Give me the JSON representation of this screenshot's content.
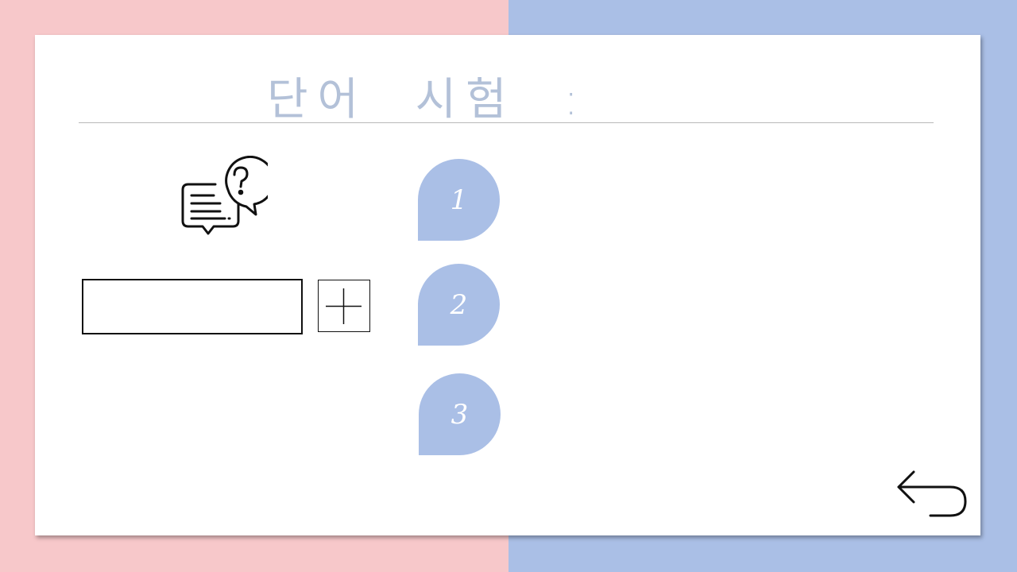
{
  "slide": {
    "title": "단어  시험  :",
    "colors": {
      "background_left": "#f7c8ca",
      "background_right": "#aabfe6",
      "title": "#b3c1d8",
      "bubble": "#aabfe6"
    }
  },
  "question_icon": "chat-question-icon",
  "word_input": {
    "value": "",
    "placeholder": ""
  },
  "add_button": {
    "icon": "plus-icon"
  },
  "answers": [
    {
      "number": "1"
    },
    {
      "number": "2"
    },
    {
      "number": "3"
    }
  ],
  "back_button": {
    "icon": "return-arrow-icon"
  }
}
